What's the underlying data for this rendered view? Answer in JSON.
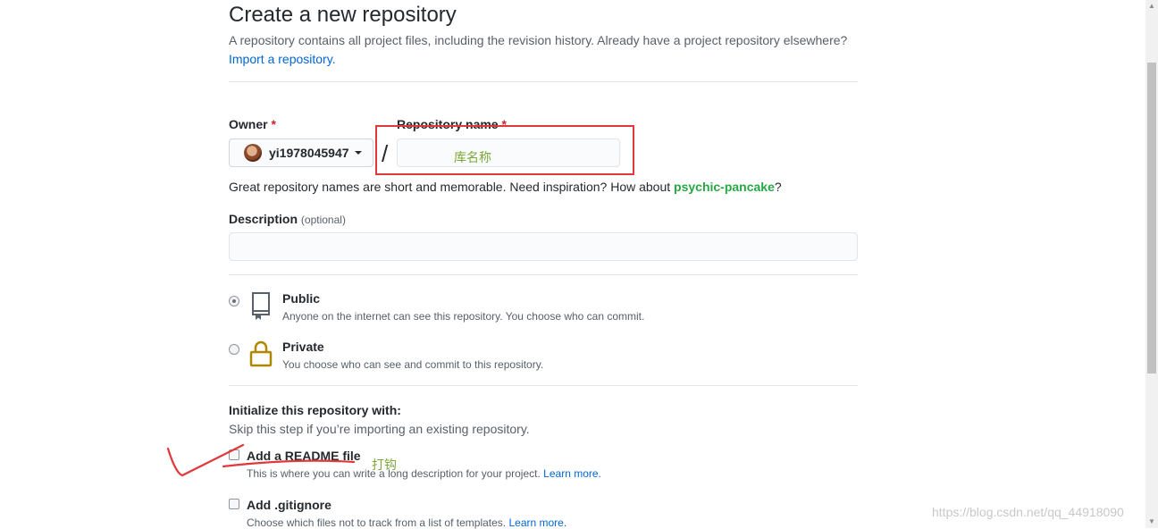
{
  "header": {
    "title": "Create a new repository",
    "subtitle": "A repository contains all project files, including the revision history. Already have a project repository elsewhere?",
    "import_link": "Import a repository."
  },
  "owner": {
    "label": "Owner",
    "required_mark": "*",
    "selected": "yi1978045947"
  },
  "repo_name": {
    "label": "Repository name",
    "required_mark": "*",
    "value": "",
    "separator": "/"
  },
  "name_hint": {
    "prefix": "Great repository names are short and memorable. Need inspiration? How about ",
    "suggestion": "psychic-pancake",
    "suffix": "?"
  },
  "description": {
    "label": "Description",
    "optional": "(optional)",
    "value": ""
  },
  "visibility": {
    "selected": "public",
    "public": {
      "title": "Public",
      "desc": "Anyone on the internet can see this repository. You choose who can commit."
    },
    "private": {
      "title": "Private",
      "desc": "You choose who can see and commit to this repository."
    }
  },
  "init": {
    "title": "Initialize this repository with:",
    "subtitle": "Skip this step if you’re importing an existing repository.",
    "readme": {
      "label": "Add a README file",
      "desc": "This is where you can write a long description for your project.",
      "link": "Learn more.",
      "checked": false
    },
    "gitignore": {
      "label": "Add .gitignore",
      "desc": "Choose which files not to track from a list of templates.",
      "link": "Learn more.",
      "checked": false
    }
  },
  "annotations": {
    "name_box": "库名称",
    "check_note": "打钩",
    "color": "#e0383b"
  },
  "watermark": "https://blog.csdn.net/qq_44918090",
  "colors": {
    "link": "#0366d6",
    "suggestion": "#28a745",
    "required": "#cb2431",
    "annotation_text": "#7ca83a"
  }
}
